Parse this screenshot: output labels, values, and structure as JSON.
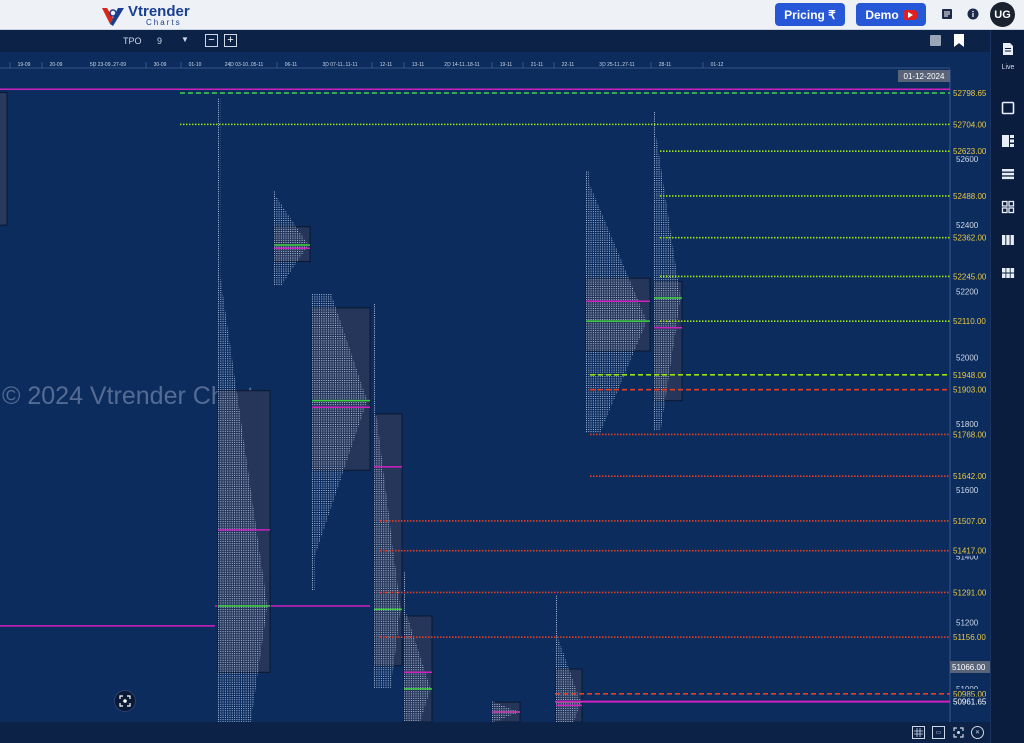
{
  "app": {
    "brand_title": "Vtrender",
    "brand_sub": "Charts",
    "pricing_label": "Pricing ₹",
    "demo_label": "Demo",
    "avatar_initials": "UG",
    "menu_icon": "list-icon",
    "info_icon": "info-icon"
  },
  "toolbar": {
    "tpo_label": "TPO",
    "tpo_value": "9",
    "zoom_out": "−",
    "zoom_in": "+"
  },
  "sidebar": {
    "live_label": "Live",
    "items": [
      "document-icon",
      "square-icon",
      "split-icon",
      "list-icon",
      "grid-icon",
      "columns-icon",
      "tiles-icon"
    ]
  },
  "watermark": "© 2024 Vtrender Charts",
  "chart_data": {
    "type": "market-profile",
    "title": "",
    "xlabel": "",
    "ylabel": "Price",
    "x_tick_labels": [
      "19-09",
      "20-09",
      "5D 23-09..27-09",
      "30-09",
      "01-10",
      "24D 03-10..05-11",
      "06-11",
      "3D 07-11..11-11",
      "12-11",
      "13-11",
      "2D 14-11..18-11",
      "19-11",
      "21-11",
      "22-11",
      "3D 25-11..27-11",
      "28-11",
      "01-12"
    ],
    "current_date_label": "01-12-2024",
    "y_ticks": [
      52800,
      52600,
      52400,
      52200,
      52000,
      51800,
      51600,
      51400,
      51200,
      51000
    ],
    "ylim": [
      50900,
      52850
    ],
    "current_price_label": "51066.00",
    "levels": [
      {
        "value": 52798.65,
        "label": "52798.65",
        "style": "dashed",
        "color": "#39d353"
      },
      {
        "value": 52704.0,
        "label": "52704.00",
        "style": "dotted",
        "color": "#9be30f"
      },
      {
        "value": 52623.0,
        "label": "52623.00",
        "style": "dotted",
        "color": "#9be30f"
      },
      {
        "value": 52488.0,
        "label": "52488.00",
        "style": "dotted",
        "color": "#9be30f"
      },
      {
        "value": 52362.0,
        "label": "52362.00",
        "style": "dotted",
        "color": "#9be30f"
      },
      {
        "value": 52245.0,
        "label": "52245.00",
        "style": "dotted",
        "color": "#9be30f"
      },
      {
        "value": 52110.0,
        "label": "52110.00",
        "style": "dotted",
        "color": "#9be30f"
      },
      {
        "value": 51948.0,
        "label": "51948.00",
        "style": "dashed",
        "color": "#9be30f"
      },
      {
        "value": 51903.0,
        "label": "51903.00",
        "style": "dashed",
        "color": "#e0402a"
      },
      {
        "value": 51768.0,
        "label": "51768.00",
        "style": "dotted",
        "color": "#e0402a"
      },
      {
        "value": 51642.0,
        "label": "51642.00",
        "style": "dotted",
        "color": "#e0402a"
      },
      {
        "value": 51507.0,
        "label": "51507.00",
        "style": "dotted",
        "color": "#e0402a"
      },
      {
        "value": 51417.0,
        "label": "51417.00",
        "style": "dotted",
        "color": "#e0402a"
      },
      {
        "value": 51291.0,
        "label": "51291.00",
        "style": "dotted",
        "color": "#e0402a"
      },
      {
        "value": 51156.0,
        "label": "51156.00",
        "style": "dotted",
        "color": "#e0402a"
      },
      {
        "value": 50985.0,
        "label": "50985.00",
        "style": "dashed",
        "color": "#e0402a"
      },
      {
        "value": 50961.65,
        "label": "50961.65",
        "style": "solid",
        "color": "#d020c0"
      }
    ],
    "profiles": [
      {
        "date": "24D 03-10..05-11",
        "high": 52780,
        "low": 50900,
        "va_high": 51900,
        "va_low": 51050,
        "poc": 51250,
        "vwap": 51480
      },
      {
        "date": "06-11",
        "high": 52500,
        "low": 52220,
        "va_high": 52395,
        "va_low": 52290,
        "poc": 52340,
        "vwap": 52330
      },
      {
        "date": "3D 07-11..11-11",
        "high": 52190,
        "low": 51300,
        "va_high": 52150,
        "va_low": 51660,
        "poc": 51870,
        "vwap": 51850
      },
      {
        "date": "12-11",
        "high": 52160,
        "low": 51000,
        "va_high": 51830,
        "va_low": 51070,
        "poc": 51240,
        "vwap": 51670
      },
      {
        "date": "13-11",
        "high": 51350,
        "low": 50900,
        "va_high": 51220,
        "va_low": 50900,
        "poc": 51000,
        "vwap": 51050
      },
      {
        "date": "21-11",
        "high": 50960,
        "low": 50900,
        "va_high": 50960,
        "va_low": 50900,
        "poc": 50930,
        "vwap": 50930
      },
      {
        "date": "22-11",
        "high": 51280,
        "low": 50900,
        "va_high": 51060,
        "va_low": 50900,
        "poc": 50960,
        "vwap": 50950
      },
      {
        "date": "3D 25-11..27-11",
        "high": 52560,
        "low": 51770,
        "va_high": 52240,
        "va_low": 52020,
        "poc": 52110,
        "vwap": 52170
      },
      {
        "date": "28-11",
        "high": 52740,
        "low": 51780,
        "va_high": 52230,
        "va_low": 51870,
        "poc": 52180,
        "vwap": 52090
      }
    ]
  }
}
